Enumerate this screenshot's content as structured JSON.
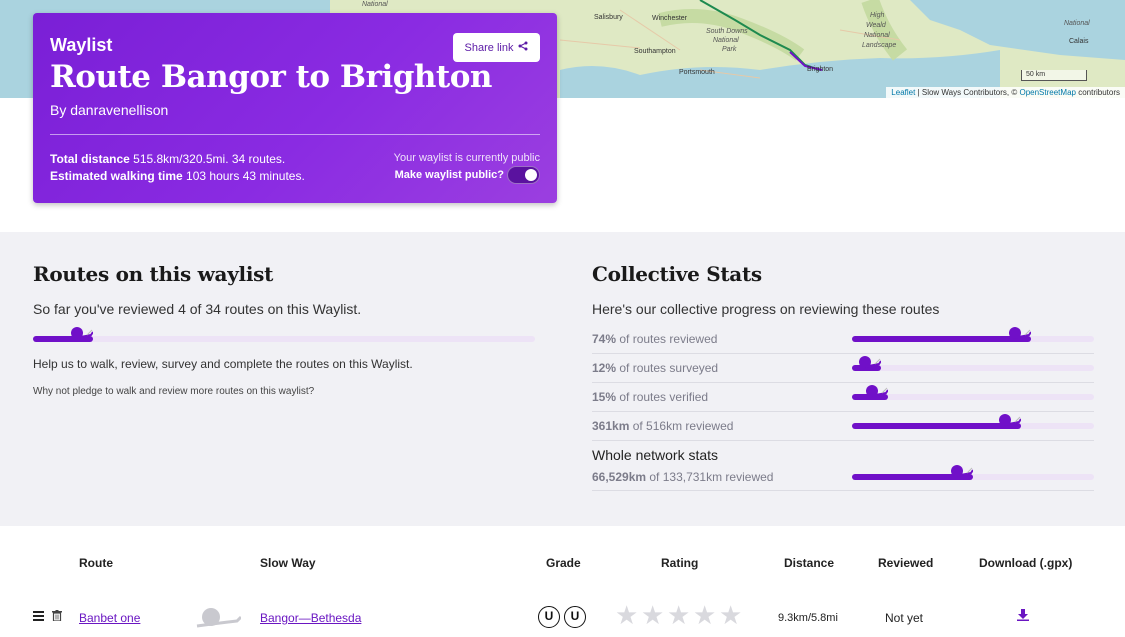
{
  "map": {
    "places": [
      "National",
      "Salisbury",
      "Winchester",
      "South Downs",
      "National",
      "Park",
      "Southampton",
      "Portsmouth",
      "Brighton",
      "High",
      "Weald",
      "National",
      "Landscape",
      "Calais",
      "National"
    ],
    "scale_label": "50 km",
    "attribution_prefix": "Leaflet",
    "attribution_middle": " | Slow Ways Contributors, © ",
    "attribution_link": "OpenStreetMap",
    "attribution_suffix": " contributors"
  },
  "hero": {
    "kicker": "Waylist",
    "title": "Route Bangor to Brighton",
    "byline": "By danravenellison",
    "share_label": "Share link",
    "total_distance_label": "Total distance",
    "total_distance_value": "515.8km/320.5mi. 34 routes.",
    "walking_time_label": "Estimated walking time",
    "walking_time_value": "103 hours 43 minutes.",
    "public_note": "Your waylist is currently public",
    "public_question": "Make waylist public?",
    "is_public": true
  },
  "routes_section": {
    "title": "Routes on this waylist",
    "reviewed_text": "So far you've reviewed 4 of 34 routes on this Waylist.",
    "reviewed_fraction": 0.12,
    "help_text": "Help us to walk, review, survey and complete the routes on this Waylist.",
    "pledge_text": "Why not pledge to walk and review more routes on this waylist?"
  },
  "collective": {
    "title": "Collective Stats",
    "intro": "Here's our collective progress on reviewing these routes",
    "rows": [
      {
        "value": "74%",
        "label": " of routes reviewed",
        "fraction": 0.74
      },
      {
        "value": "12%",
        "label": " of routes surveyed",
        "fraction": 0.12
      },
      {
        "value": "15%",
        "label": " of routes verified",
        "fraction": 0.15
      },
      {
        "value": "361km",
        "label": " of 516km reviewed",
        "fraction": 0.7
      }
    ],
    "network_title": "Whole network stats",
    "network_value": "66,529km",
    "network_label": " of 133,731km reviewed",
    "network_fraction": 0.5
  },
  "table": {
    "headers": {
      "route": "Route",
      "slow_way": "Slow Way",
      "grade": "Grade",
      "rating": "Rating",
      "distance": "Distance",
      "reviewed": "Reviewed",
      "download": "Download (.gpx)"
    },
    "rows": [
      {
        "route": "Banbet one",
        "slow_way": "Bangor—Bethesda",
        "grades": [
          "U",
          "U"
        ],
        "rating": 0,
        "distance": "9.3km/5.8mi",
        "reviewed": "Not yet"
      }
    ]
  },
  "colors": {
    "accent": "#7010c8",
    "hero_bg": "#8a2be2",
    "section_bg": "#f1f1f5"
  }
}
